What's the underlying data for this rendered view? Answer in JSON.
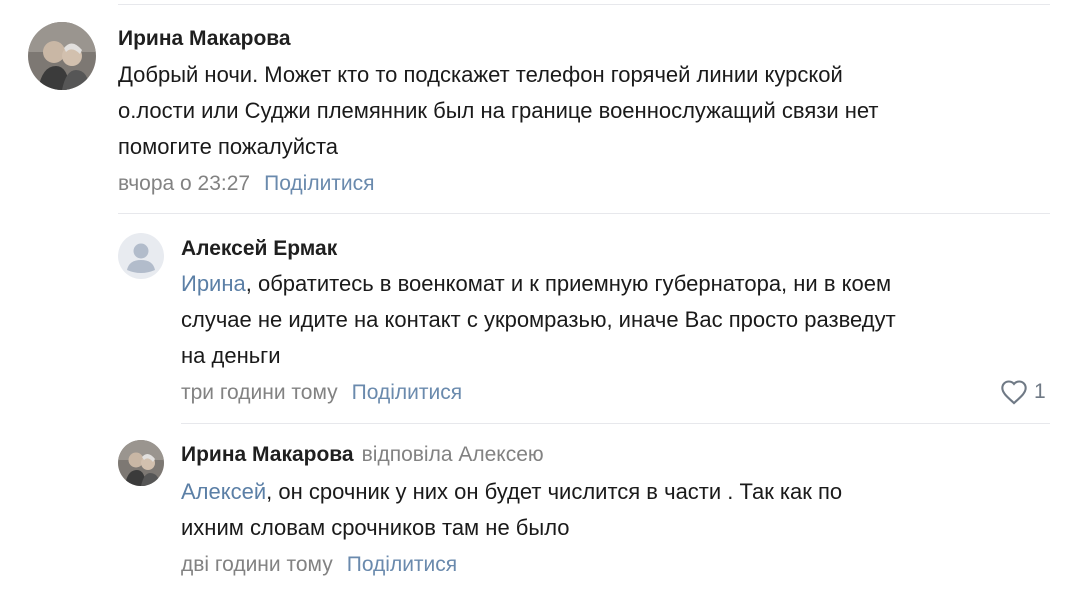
{
  "comments": [
    {
      "author": "Ирина Макарова",
      "text_lines": [
        "Добрый ночи. Может кто то подскажет телефон горячей линии курской",
        "о.лости или Суджи племянник был на границе военнослужащий связи нет",
        "помогите пожалуйста"
      ],
      "time": "вчора о 23:27",
      "share_label": "Поділитися"
    },
    {
      "author": "Алексей Ермак",
      "mention": "Ирина",
      "text_lines": [
        ", обратитесь в военкомат и к приемную губернатора, ни в коем",
        "случае не идите на контакт с укромразью, иначе Вас просто разведут",
        "на деньги"
      ],
      "time": "три години тому",
      "share_label": "Поділитися",
      "likes": "1"
    },
    {
      "author": "Ирина Макарова",
      "replied_to": "відповіла Алексею",
      "mention": "Алексей",
      "text_lines": [
        ", он срочник у них он будет числится в части . Так как по",
        "ихним словам срочников там не было"
      ],
      "time": "дві години тому",
      "share_label": "Поділитися"
    }
  ],
  "colors": {
    "link": "#5b7fa6",
    "meta": "#828282",
    "divider": "#e7e8ec"
  }
}
